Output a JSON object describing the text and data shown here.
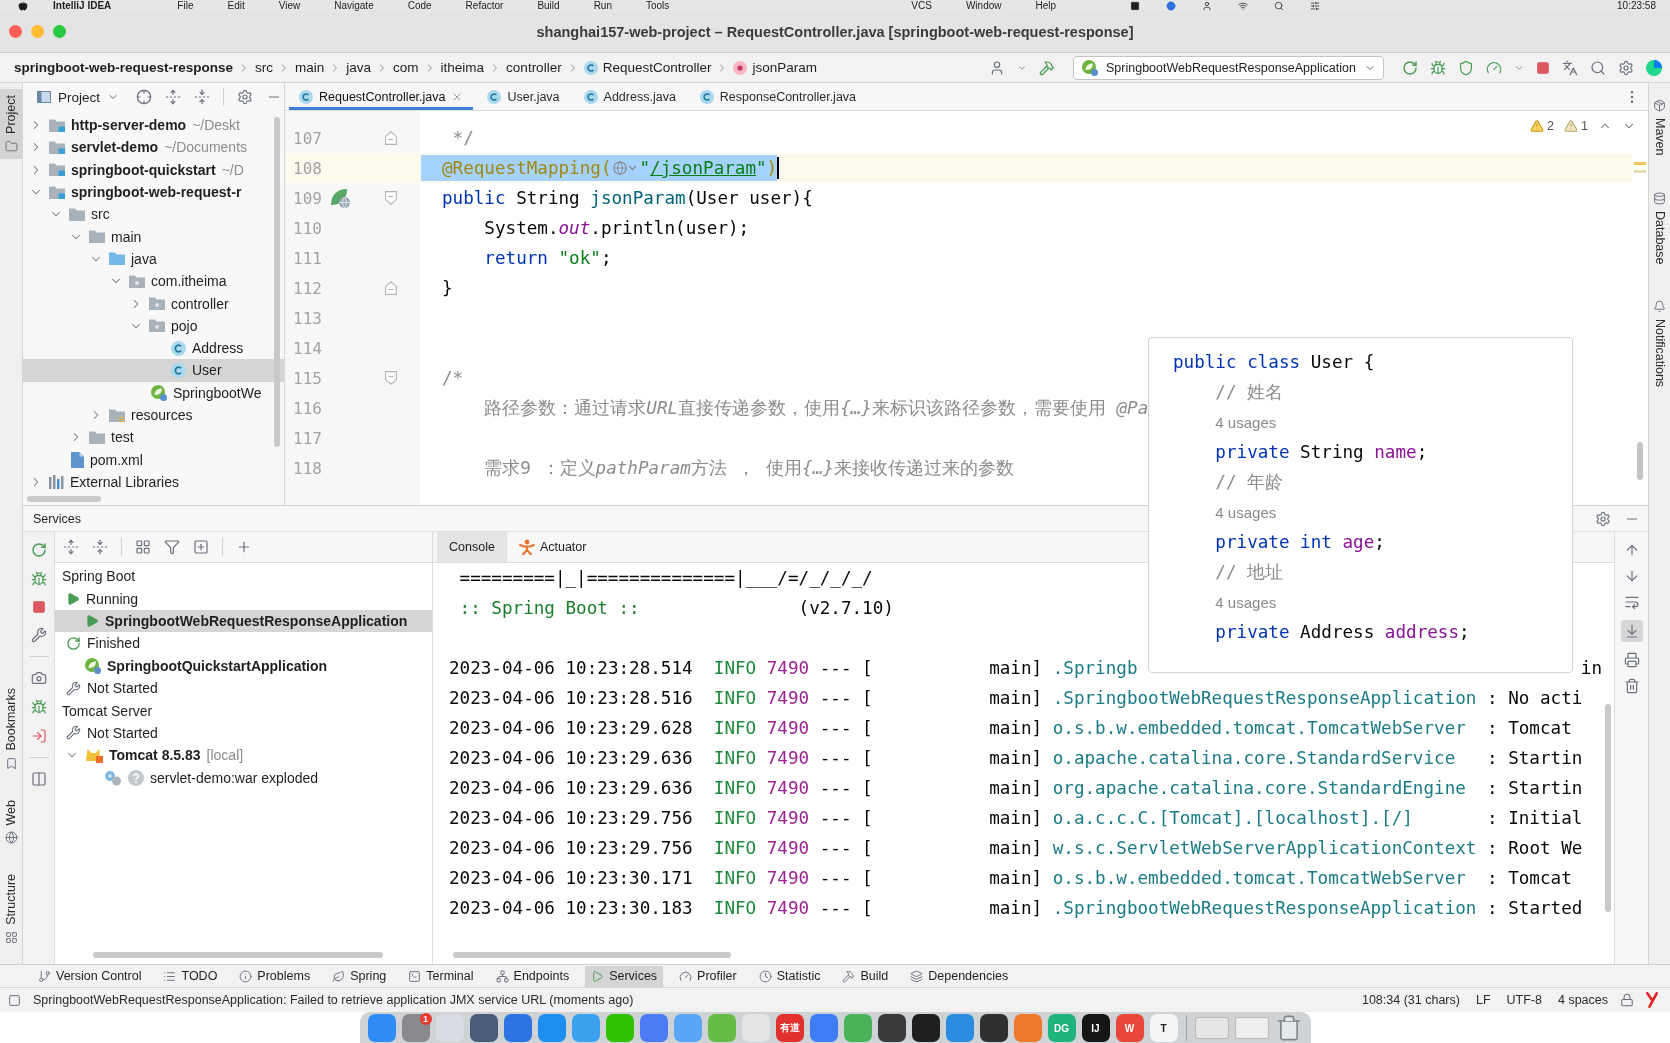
{
  "menu_bar": {
    "app": "IntelliJ IDEA",
    "items": [
      "File",
      "Edit",
      "View",
      "Navigate",
      "Code",
      "Refactor",
      "Build",
      "Run",
      "Tools"
    ],
    "more_items": [
      "VCS",
      "Window",
      "Help"
    ],
    "clock": "10:23:58"
  },
  "window": {
    "title": "shanghai157-web-project – RequestController.java [springboot-web-request-response]"
  },
  "breadcrumbs": [
    {
      "label": "springboot-web-request-response",
      "kind": "project"
    },
    {
      "label": "src",
      "kind": "folder"
    },
    {
      "label": "main",
      "kind": "folder"
    },
    {
      "label": "java",
      "kind": "folder"
    },
    {
      "label": "com",
      "kind": "folder"
    },
    {
      "label": "itheima",
      "kind": "folder"
    },
    {
      "label": "controller",
      "kind": "folder"
    },
    {
      "label": "RequestController",
      "kind": "class"
    },
    {
      "label": "jsonParam",
      "kind": "method"
    }
  ],
  "run_config": {
    "label": "SpringbootWebRequestResponseApplication"
  },
  "left_tool_windows": {
    "top": [
      {
        "label": "Project",
        "kind": "project",
        "selected": true
      }
    ],
    "bottom": [
      {
        "label": "Bookmarks",
        "kind": "bookmarks",
        "selected": false
      },
      {
        "label": "Web",
        "kind": "web",
        "selected": false
      },
      {
        "label": "Structure",
        "kind": "structure",
        "selected": false
      }
    ]
  },
  "right_tool_windows": [
    {
      "label": "Maven",
      "kind": "maven"
    },
    {
      "label": "Database",
      "kind": "database"
    },
    {
      "label": "Notifications",
      "kind": "notifications"
    }
  ],
  "project_panel": {
    "title": "Project",
    "tree": [
      {
        "label": "http-server-demo",
        "suffix": "~/Deskt",
        "kind": "module",
        "expanded": false,
        "selected": false
      },
      {
        "label": "servlet-demo",
        "suffix": "~/Documents",
        "kind": "module",
        "expanded": false,
        "selected": false
      },
      {
        "label": "springboot-quickstart",
        "suffix": "~/D",
        "kind": "module",
        "expanded": false,
        "selected": false
      },
      {
        "label": "springboot-web-request-r",
        "kind": "module",
        "expanded": true,
        "selected": false,
        "children": [
          {
            "label": "src",
            "kind": "folder",
            "expanded": true,
            "selected": false,
            "children": [
              {
                "label": "main",
                "kind": "folder",
                "expanded": true,
                "selected": false,
                "children": [
                  {
                    "label": "java",
                    "kind": "source",
                    "expanded": true,
                    "selected": false,
                    "children": [
                      {
                        "label": "com.itheima",
                        "kind": "package",
                        "expanded": true,
                        "selected": false,
                        "children": [
                          {
                            "label": "controller",
                            "kind": "package",
                            "expanded": false,
                            "selected": false
                          },
                          {
                            "label": "pojo",
                            "kind": "package",
                            "expanded": true,
                            "selected": false,
                            "children": [
                              {
                                "label": "Address",
                                "kind": "class",
                                "selected": false
                              },
                              {
                                "label": "User",
                                "kind": "class",
                                "selected": true
                              }
                            ]
                          },
                          {
                            "label": "SpringbootWe",
                            "kind": "app",
                            "selected": false
                          }
                        ]
                      }
                    ]
                  },
                  {
                    "label": "resources",
                    "kind": "resources",
                    "expanded": false,
                    "selected": false
                  }
                ]
              },
              {
                "label": "test",
                "kind": "folder",
                "expanded": false,
                "selected": false
              }
            ]
          },
          {
            "label": "pom.xml",
            "kind": "maven",
            "selected": false
          }
        ]
      },
      {
        "label": "External Libraries",
        "kind": "libraries",
        "expanded": false,
        "selected": false
      }
    ]
  },
  "editor": {
    "tabs": [
      {
        "label": "RequestController.java",
        "selected": true
      },
      {
        "label": "User.java",
        "selected": false
      },
      {
        "label": "Address.java",
        "selected": false
      },
      {
        "label": "ResponseController.java",
        "selected": false
      }
    ],
    "inspections": {
      "warnings": "2",
      "weak_warnings": "1"
    },
    "lines": [
      {
        "number": "107",
        "current": false,
        "selected": false,
        "gutter": [
          {
            "kind": "fold-end"
          }
        ],
        "tokens": [
          {
            "kind": "comment",
            "text": " */"
          }
        ]
      },
      {
        "number": "108",
        "current": true,
        "selected": true,
        "tokens": [
          {
            "kind": "annotation",
            "text": "@RequestMapping("
          },
          {
            "kind": "globe-inlay"
          },
          {
            "kind": "string",
            "text": "\""
          },
          {
            "kind": "link",
            "text": "/jsonParam"
          },
          {
            "kind": "string",
            "text": "\""
          },
          {
            "kind": "annotation",
            "text": ")"
          }
        ]
      },
      {
        "number": "109",
        "current": false,
        "selected": false,
        "gutter": [
          {
            "kind": "run"
          },
          {
            "kind": "fold-start"
          }
        ],
        "tokens": [
          {
            "kind": "keyword",
            "text": "public"
          },
          {
            "kind": "plain",
            "text": " String "
          },
          {
            "kind": "method",
            "text": "jsonParam"
          },
          {
            "kind": "plain",
            "text": "(User user){"
          }
        ]
      },
      {
        "number": "110",
        "current": false,
        "selected": false,
        "tokens": [
          {
            "kind": "plain",
            "text": "    System."
          },
          {
            "kind": "static",
            "text": "out"
          },
          {
            "kind": "plain",
            "text": ".println(user);"
          }
        ]
      },
      {
        "number": "111",
        "current": false,
        "selected": false,
        "tokens": [
          {
            "kind": "keyword",
            "text": "    return"
          },
          {
            "kind": "string",
            "text": " \"ok\""
          },
          {
            "kind": "plain",
            "text": ";"
          }
        ]
      },
      {
        "number": "112",
        "current": false,
        "selected": false,
        "gutter": [
          {
            "kind": "fold-end"
          }
        ],
        "tokens": [
          {
            "kind": "plain",
            "text": "}"
          }
        ]
      },
      {
        "number": "113",
        "current": false,
        "selected": false
      },
      {
        "number": "114",
        "current": false,
        "selected": false
      },
      {
        "number": "115",
        "current": false,
        "selected": false,
        "gutter": [
          {
            "kind": "fold-start"
          }
        ],
        "tokens": [
          {
            "kind": "comment",
            "text": "/*"
          }
        ]
      },
      {
        "number": "116",
        "current": false,
        "selected": false,
        "tokens": [
          {
            "kind": "comment",
            "text": "    路径参数：通过请求"
          },
          {
            "kind": "comment-italic",
            "text": "URL"
          },
          {
            "kind": "comment",
            "text": "直接传递参数，使用"
          },
          {
            "kind": "comment-italic",
            "text": "{…}"
          },
          {
            "kind": "comment",
            "text": "来标识该路径参数，需要使用 "
          },
          {
            "kind": "comment-italic",
            "text": "@Pa"
          }
        ]
      },
      {
        "number": "117",
        "current": false,
        "selected": false
      },
      {
        "number": "118",
        "current": false,
        "selected": false,
        "tokens": [
          {
            "kind": "comment",
            "text": "    需求9 ：定义"
          },
          {
            "kind": "comment-italic",
            "text": "pathParam"
          },
          {
            "kind": "comment",
            "text": "方法 ， 使用"
          },
          {
            "kind": "comment-italic",
            "text": "{…}"
          },
          {
            "kind": "comment",
            "text": "来接收传递过来的参数"
          }
        ]
      }
    ]
  },
  "quick_definition": {
    "lines": [
      {
        "tokens": [
          {
            "kind": "keyword",
            "text": "public class"
          },
          {
            "kind": "plain",
            "text": " User {"
          }
        ]
      },
      {
        "tokens": [
          {
            "kind": "comment",
            "text": "    // 姓名"
          }
        ]
      },
      {
        "tokens": [
          {
            "kind": "hint",
            "text": "    4 usages"
          }
        ]
      },
      {
        "tokens": [
          {
            "kind": "keyword",
            "text": "    private"
          },
          {
            "kind": "plain",
            "text": " String "
          },
          {
            "kind": "field",
            "text": "name"
          },
          {
            "kind": "plain",
            "text": ";"
          }
        ]
      },
      {
        "tokens": [
          {
            "kind": "comment",
            "text": "    // 年龄"
          }
        ]
      },
      {
        "tokens": [
          {
            "kind": "hint",
            "text": "    4 usages"
          }
        ]
      },
      {
        "tokens": [
          {
            "kind": "keyword",
            "text": "    private int"
          },
          {
            "kind": "field",
            "text": " age"
          },
          {
            "kind": "plain",
            "text": ";"
          }
        ]
      },
      {
        "tokens": [
          {
            "kind": "comment",
            "text": "    // 地址"
          }
        ]
      },
      {
        "tokens": [
          {
            "kind": "hint",
            "text": "    4 usages"
          }
        ]
      },
      {
        "tokens": [
          {
            "kind": "keyword",
            "text": "    private"
          },
          {
            "kind": "plain",
            "text": " Address "
          },
          {
            "kind": "field",
            "text": "address"
          },
          {
            "kind": "plain",
            "text": ";"
          }
        ]
      }
    ]
  },
  "services": {
    "title": "Services",
    "tree": [
      {
        "label": "Spring Boot",
        "selected": false,
        "children": [
          {
            "label": "Running",
            "kind": "running",
            "selected": false,
            "children": [
              {
                "label": "SpringbootWebRequestResponseApplication",
                "kind": "app-running",
                "selected": true
              }
            ]
          },
          {
            "label": "Finished",
            "kind": "finished",
            "selected": false,
            "children": [
              {
                "label": "SpringbootQuickstartApplication",
                "kind": "app",
                "selected": false
              }
            ]
          },
          {
            "label": "Not Started",
            "kind": "not-started",
            "selected": false
          }
        ]
      },
      {
        "label": "Tomcat Server",
        "selected": false,
        "children": [
          {
            "label": "Not Started",
            "kind": "not-started",
            "selected": false,
            "children": [
              {
                "label": "Tomcat 8.5.83",
                "suffix": "[local]",
                "kind": "tomcat",
                "selected": false,
                "expanded": true,
                "children": [
                  {
                    "label": "servlet-demo:war exploded",
                    "kind": "artifact",
                    "selected": false
                  }
                ]
              }
            ]
          }
        ]
      }
    ],
    "console_tabs": [
      {
        "label": "Console",
        "kind": "console",
        "selected": true
      },
      {
        "label": "Actuator",
        "kind": "actuator",
        "selected": false
      }
    ],
    "console": {
      "banner": [
        {
          "segments": [
            {
              "kind": "plain",
              "text": " =========|_|==============|___/=/_/_/_/"
            }
          ]
        },
        {
          "segments": [
            {
              "kind": "banner",
              "text": " :: Spring Boot ::"
            },
            {
              "kind": "plain",
              "text": "               (v2.7.10)"
            }
          ]
        }
      ],
      "log": [
        {
          "segments": [
            {
              "kind": "time",
              "text": "2023-04-06 10:23:28.514"
            },
            {
              "kind": "level",
              "text": "INFO"
            },
            {
              "kind": "pid",
              "text": "7490"
            },
            {
              "kind": "plain",
              "text": "--- [           main]"
            },
            {
              "kind": "logger",
              "text": ".Springb"
            },
            {
              "kind": "edge",
              "text": "in"
            }
          ]
        },
        {
          "segments": [
            {
              "kind": "time",
              "text": "2023-04-06 10:23:28.516"
            },
            {
              "kind": "level",
              "text": "INFO"
            },
            {
              "kind": "pid",
              "text": "7490"
            },
            {
              "kind": "plain",
              "text": "--- [           main]"
            },
            {
              "kind": "logger",
              "text": ".SpringbootWebRequestResponseApplication"
            },
            {
              "kind": "message",
              "text": ": No acti"
            }
          ]
        },
        {
          "segments": [
            {
              "kind": "time",
              "text": "2023-04-06 10:23:29.628"
            },
            {
              "kind": "level",
              "text": "INFO"
            },
            {
              "kind": "pid",
              "text": "7490"
            },
            {
              "kind": "plain",
              "text": "--- [           main]"
            },
            {
              "kind": "logger",
              "text": "o.s.b.w.embedded.tomcat.TomcatWebServer"
            },
            {
              "kind": "message",
              "text": ": Tomcat"
            }
          ]
        },
        {
          "segments": [
            {
              "kind": "time",
              "text": "2023-04-06 10:23:29.636"
            },
            {
              "kind": "level",
              "text": "INFO"
            },
            {
              "kind": "pid",
              "text": "7490"
            },
            {
              "kind": "plain",
              "text": "--- [           main]"
            },
            {
              "kind": "logger",
              "text": "o.apache.catalina.core.StandardService"
            },
            {
              "kind": "message",
              "text": ": Startin"
            }
          ]
        },
        {
          "segments": [
            {
              "kind": "time",
              "text": "2023-04-06 10:23:29.636"
            },
            {
              "kind": "level",
              "text": "INFO"
            },
            {
              "kind": "pid",
              "text": "7490"
            },
            {
              "kind": "plain",
              "text": "--- [           main]"
            },
            {
              "kind": "logger",
              "text": "org.apache.catalina.core.StandardEngine"
            },
            {
              "kind": "message",
              "text": ": Startin"
            }
          ]
        },
        {
          "segments": [
            {
              "kind": "time",
              "text": "2023-04-06 10:23:29.756"
            },
            {
              "kind": "level",
              "text": "INFO"
            },
            {
              "kind": "pid",
              "text": "7490"
            },
            {
              "kind": "plain",
              "text": "--- [           main]"
            },
            {
              "kind": "logger",
              "text": "o.a.c.c.C.[Tomcat].[localhost].[/]"
            },
            {
              "kind": "message",
              "text": ": Initial"
            }
          ]
        },
        {
          "segments": [
            {
              "kind": "time",
              "text": "2023-04-06 10:23:29.756"
            },
            {
              "kind": "level",
              "text": "INFO"
            },
            {
              "kind": "pid",
              "text": "7490"
            },
            {
              "kind": "plain",
              "text": "--- [           main]"
            },
            {
              "kind": "logger",
              "text": "w.s.c.ServletWebServerApplicationContext"
            },
            {
              "kind": "message",
              "text": ": Root We"
            }
          ]
        },
        {
          "segments": [
            {
              "kind": "time",
              "text": "2023-04-06 10:23:30.171"
            },
            {
              "kind": "level",
              "text": "INFO"
            },
            {
              "kind": "pid",
              "text": "7490"
            },
            {
              "kind": "plain",
              "text": "--- [           main]"
            },
            {
              "kind": "logger",
              "text": "o.s.b.w.embedded.tomcat.TomcatWebServer"
            },
            {
              "kind": "message",
              "text": ": Tomcat"
            }
          ]
        },
        {
          "segments": [
            {
              "kind": "time",
              "text": "2023-04-06 10:23:30.183"
            },
            {
              "kind": "level",
              "text": "INFO"
            },
            {
              "kind": "pid",
              "text": "7490"
            },
            {
              "kind": "plain",
              "text": "--- [           main]"
            },
            {
              "kind": "logger",
              "text": ".SpringbootWebRequestResponseApplication"
            },
            {
              "kind": "message",
              "text": ": Started"
            }
          ]
        }
      ]
    },
    "console_toolbar": [
      {
        "kind": "up",
        "selected": false
      },
      {
        "kind": "down",
        "selected": false
      },
      {
        "kind": "wrap",
        "selected": false
      },
      {
        "kind": "scroll-end",
        "selected": true
      },
      {
        "kind": "print",
        "selected": false
      },
      {
        "kind": "trash",
        "selected": false
      }
    ]
  },
  "tool_window_bar": [
    {
      "label": "Version Control",
      "kind": "vcs",
      "selected": false
    },
    {
      "label": "TODO",
      "kind": "todo",
      "selected": false
    },
    {
      "label": "Problems",
      "kind": "problems",
      "selected": false
    },
    {
      "label": "Spring",
      "kind": "spring",
      "selected": false
    },
    {
      "label": "Terminal",
      "kind": "terminal",
      "selected": false
    },
    {
      "label": "Endpoints",
      "kind": "endpoints",
      "selected": false
    },
    {
      "label": "Services",
      "kind": "services",
      "selected": true
    },
    {
      "label": "Profiler",
      "kind": "profiler",
      "selected": false
    },
    {
      "label": "Statistic",
      "kind": "statistic",
      "selected": false
    },
    {
      "label": "Build",
      "kind": "build",
      "selected": false
    },
    {
      "label": "Dependencies",
      "kind": "dependencies",
      "selected": false
    }
  ],
  "status_bar": {
    "message": "SpringbootWebRequestResponseApplication: Failed to retrieve application JMX service URL (moments ago)",
    "position": "108:34 (31 chars)",
    "line_separator": "LF",
    "encoding": "UTF-8",
    "indent": "4 spaces"
  },
  "dock": [
    {
      "kind": "app",
      "color": "#2f8cf5"
    },
    {
      "kind": "app",
      "color": "#8a8a8e",
      "badge": "1"
    },
    {
      "kind": "app",
      "color": "#d9dde3"
    },
    {
      "kind": "app",
      "color": "#4a5a7a"
    },
    {
      "kind": "app",
      "color": "#2b74e2"
    },
    {
      "kind": "app",
      "color": "#1d8ef0"
    },
    {
      "kind": "app",
      "color": "#3aa0f0"
    },
    {
      "kind": "app",
      "color": "#2dc100"
    },
    {
      "kind": "app",
      "color": "#4d7bf3"
    },
    {
      "kind": "app",
      "color": "#5aa6f6"
    },
    {
      "kind": "app",
      "color": "#66bb44"
    },
    {
      "kind": "app",
      "color": "#e4e4e4"
    },
    {
      "kind": "app",
      "color": "#e2312d",
      "label": "有道"
    },
    {
      "kind": "app",
      "color": "#3d7cf5"
    },
    {
      "kind": "app",
      "color": "#49b35a"
    },
    {
      "kind": "app",
      "color": "#3a3a3a"
    },
    {
      "kind": "app",
      "color": "#1f1f1f"
    },
    {
      "kind": "app",
      "color": "#2a8ce0"
    },
    {
      "kind": "app",
      "color": "#303030"
    },
    {
      "kind": "app",
      "color": "#f0782a"
    },
    {
      "kind": "app",
      "color": "#1fb57a",
      "label": "DG"
    },
    {
      "kind": "app",
      "color": "#161616",
      "label": "IJ"
    },
    {
      "kind": "app",
      "color": "#e8473a",
      "label": "W"
    },
    {
      "kind": "app",
      "color": "#f5f5f5",
      "label": "T"
    },
    {
      "kind": "window",
      "color": "#e5e5e5"
    },
    {
      "kind": "window",
      "color": "#eeeeee"
    },
    {
      "kind": "trash"
    }
  ]
}
